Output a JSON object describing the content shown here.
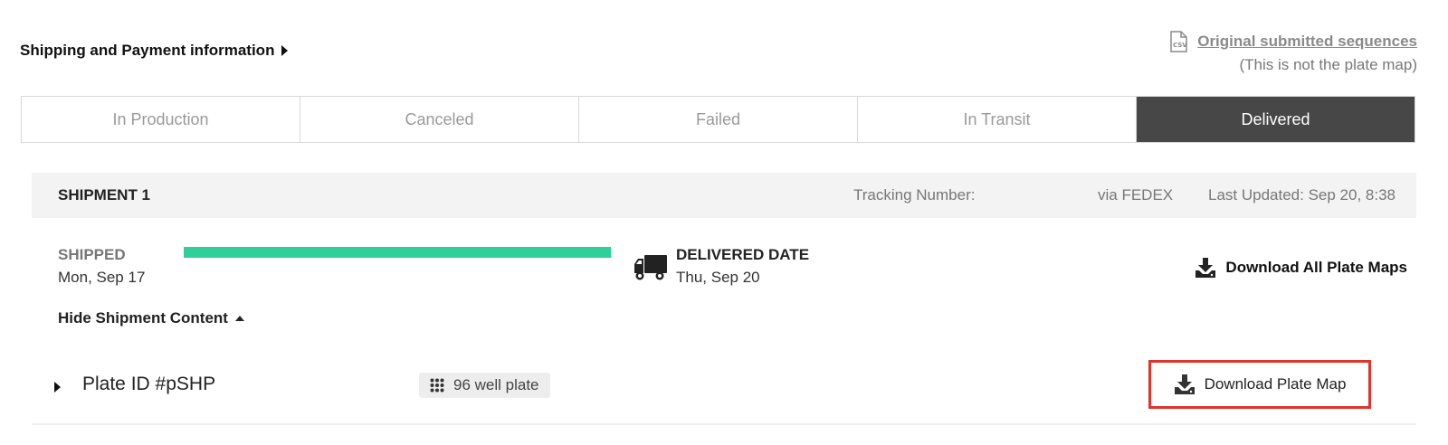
{
  "header": {
    "shipping_payment_label": "Shipping and Payment information",
    "original_sequences_link": "Original submitted sequences",
    "original_sequences_note": "(This is not the plate map)"
  },
  "tabs": [
    {
      "label": "In Production",
      "active": false
    },
    {
      "label": "Canceled",
      "active": false
    },
    {
      "label": "Failed",
      "active": false
    },
    {
      "label": "In Transit",
      "active": false
    },
    {
      "label": "Delivered",
      "active": true
    }
  ],
  "shipment": {
    "title": "SHIPMENT 1",
    "tracking_label": "Tracking Number:",
    "carrier": "via FEDEX",
    "last_updated": "Last Updated: Sep 20, 8:38",
    "shipped_label": "SHIPPED",
    "shipped_date": "Mon, Sep 17",
    "progress_percent": 100,
    "delivered_label": "DELIVERED DATE",
    "delivered_date": "Thu, Sep 20",
    "download_all_label": "Download All Plate Maps",
    "toggle_content_label": "Hide Shipment Content"
  },
  "plate": {
    "id_label": "Plate ID #pSHP",
    "type_label": "96 well plate",
    "download_label": "Download Plate Map"
  },
  "colors": {
    "active_tab_bg": "#474747",
    "progress_fill": "#2ecf99",
    "highlight_border": "#e0332a",
    "header_bg": "#f3f3f3"
  },
  "icons": {
    "csv": "csv-file-icon",
    "truck": "truck-icon",
    "download": "download-icon",
    "grid": "grid-icon"
  }
}
